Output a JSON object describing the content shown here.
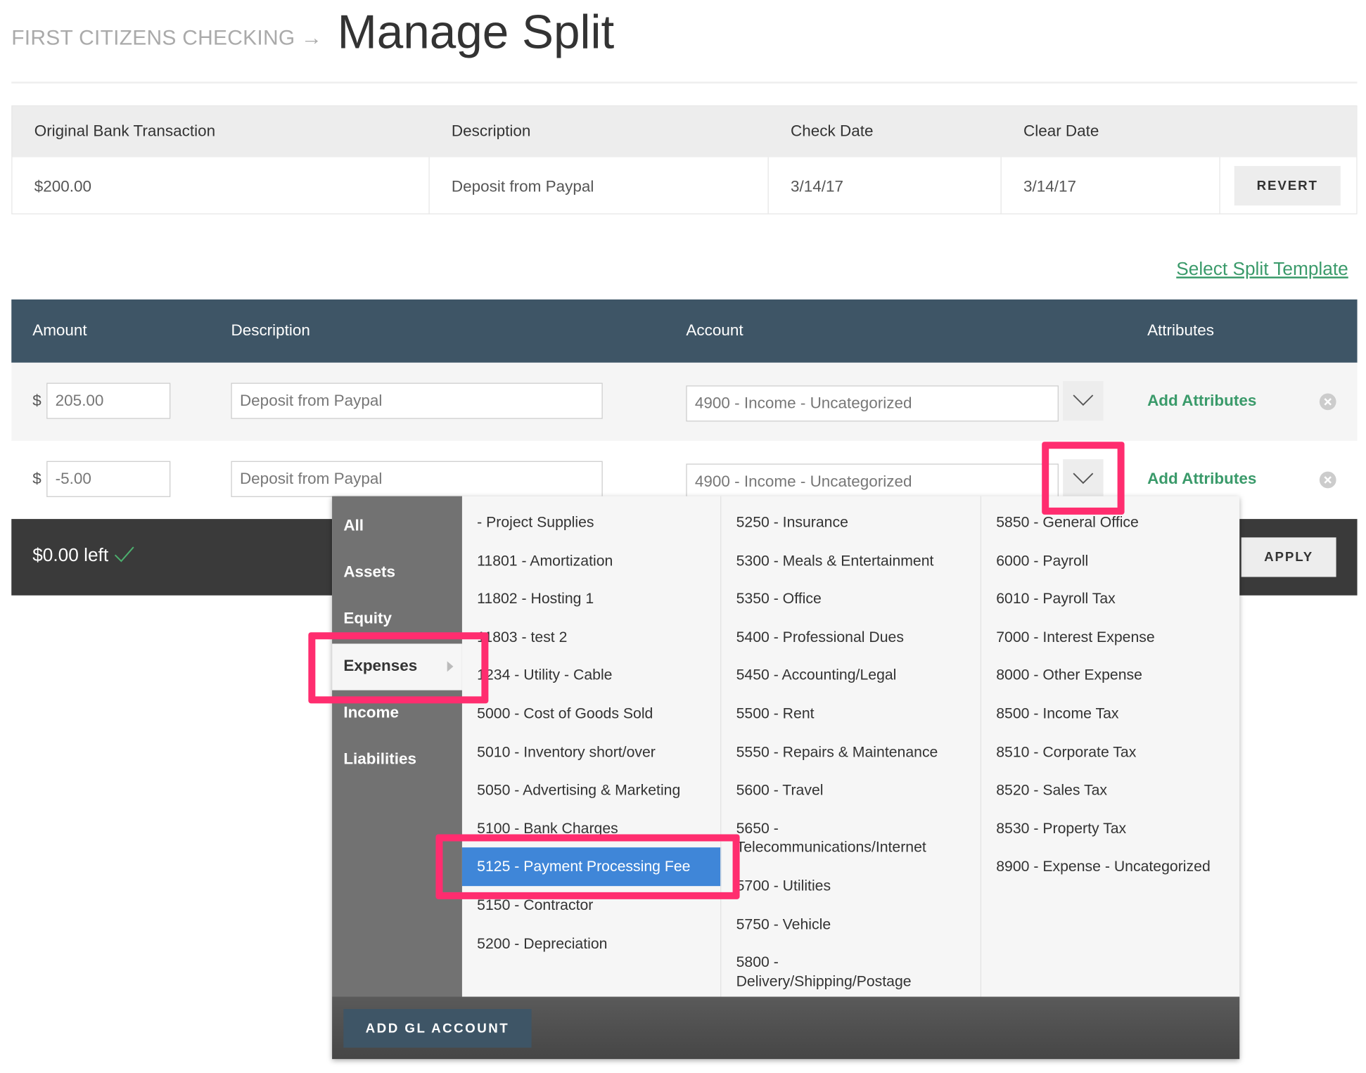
{
  "header": {
    "breadcrumb": "FIRST CITIZENS CHECKING",
    "arrow": "→",
    "title": "Manage Split"
  },
  "original": {
    "columns": [
      "Original Bank Transaction",
      "Description",
      "Check Date",
      "Clear Date"
    ],
    "row": {
      "amount": "$200.00",
      "description": "Deposit from Paypal",
      "check_date": "3/14/17",
      "clear_date": "3/14/17"
    },
    "revert_label": "REVERT"
  },
  "select_template_label": "Select Split Template",
  "split": {
    "columns": [
      "Amount",
      "Description",
      "Account",
      "Attributes"
    ],
    "currency": "$",
    "rows": [
      {
        "amount": "205.00",
        "description": "Deposit from Paypal",
        "account": "4900 - Income - Uncategorized",
        "attributes_label": "Add Attributes"
      },
      {
        "amount": "-5.00",
        "description": "Deposit from Paypal",
        "account": "4900 - Income - Uncategorized",
        "attributes_label": "Add Attributes"
      }
    ],
    "remaining": "$0.00 left",
    "apply_label": "APPLY"
  },
  "dropdown": {
    "categories": [
      "All",
      "Assets",
      "Equity",
      "Expenses",
      "Income",
      "Liabilities"
    ],
    "selected_category": "Expenses",
    "columns": [
      [
        "- Project Supplies",
        "11801 - Amortization",
        "11802 - Hosting 1",
        "11803 - test 2",
        "1234 - Utility - Cable",
        "5000 - Cost of Goods Sold",
        "5010 - Inventory short/over",
        "5050 - Advertising & Marketing",
        "5100 - Bank Charges",
        "5125 - Payment Processing Fee",
        "5150 - Contractor",
        "5200 - Depreciation"
      ],
      [
        "5250 - Insurance",
        "5300 - Meals & Entertainment",
        "5350 - Office",
        "5400 - Professional Dues",
        "5450 - Accounting/Legal",
        "5500 - Rent",
        "5550 - Repairs & Maintenance",
        "5600 - Travel",
        "5650 - Telecommunications/Internet",
        "5700 - Utilities",
        "5750 - Vehicle",
        "5800 - Delivery/Shipping/Postage"
      ],
      [
        "5850 - General Office",
        "6000 - Payroll",
        "6010 - Payroll Tax",
        "7000 - Interest Expense",
        "8000 - Other Expense",
        "8500 - Income Tax",
        "8510 - Corporate Tax",
        "8520 - Sales Tax",
        "8530 - Property Tax",
        "8900 - Expense - Uncategorized"
      ]
    ],
    "highlighted": "5125 - Payment Processing Fee",
    "add_gl_label": "ADD GL ACCOUNT"
  },
  "colors": {
    "header_bg": "#3e5566",
    "accent_green": "#3a9a6a",
    "highlight_blue": "#3f86d8",
    "annotation_pink": "#ff2d6f"
  }
}
